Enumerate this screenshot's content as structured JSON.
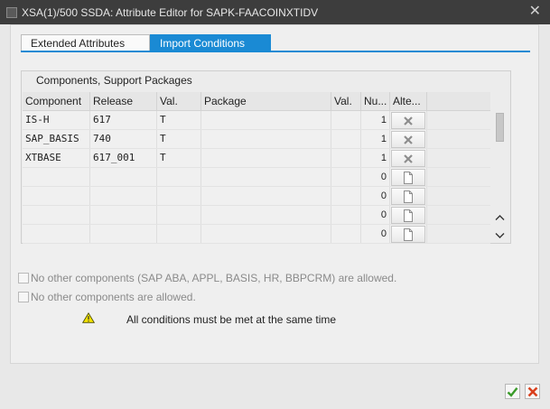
{
  "window": {
    "title": "XSA(1)/500 SSDA: Attribute Editor  for SAPK-FAACOINXTIDV",
    "close_glyph": "✕"
  },
  "tabs": [
    {
      "label": "Extended Attributes",
      "active": false
    },
    {
      "label": "Import Conditions",
      "active": true
    }
  ],
  "panel": {
    "title": "Components, Support Packages",
    "columns": [
      "Component",
      "Release",
      "Val.",
      "Package",
      "Val.",
      "Nu...",
      "Alte..."
    ],
    "rows": [
      {
        "component": "IS-H",
        "release": "617",
        "val": "T",
        "package": "",
        "val2": "",
        "num": "1",
        "action_icon": "delete-icon"
      },
      {
        "component": "SAP_BASIS",
        "release": "740",
        "val": "T",
        "package": "",
        "val2": "",
        "num": "1",
        "action_icon": "delete-icon"
      },
      {
        "component": "XTBASE",
        "release": "617_001",
        "val": "T",
        "package": "",
        "val2": "",
        "num": "1",
        "action_icon": "delete-icon"
      },
      {
        "component": "",
        "release": "",
        "val": "",
        "package": "",
        "val2": "",
        "num": "0",
        "action_icon": "new-document-icon"
      },
      {
        "component": "",
        "release": "",
        "val": "",
        "package": "",
        "val2": "",
        "num": "0",
        "action_icon": "new-document-icon"
      },
      {
        "component": "",
        "release": "",
        "val": "",
        "package": "",
        "val2": "",
        "num": "0",
        "action_icon": "new-document-icon"
      },
      {
        "component": "",
        "release": "",
        "val": "",
        "package": "",
        "val2": "",
        "num": "0",
        "action_icon": "new-document-icon"
      }
    ]
  },
  "options": {
    "no_other_sap": "No other components (SAP ABA, APPL, BASIS, HR, BBPCRM) are allowed.",
    "no_other_any": "No other components are allowed."
  },
  "notice": {
    "icon": "warning-icon",
    "text": "All conditions must be met at the same time"
  },
  "colors": {
    "accent": "#1a8ad4",
    "ok": "#3a9b2a",
    "cancel": "#d9401e"
  }
}
